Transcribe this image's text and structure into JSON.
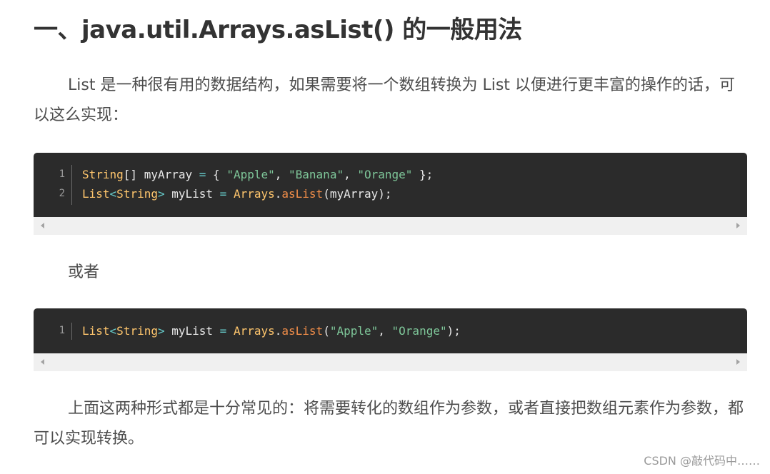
{
  "title": "一、java.util.Arrays.asList() 的一般用法",
  "paragraphs": {
    "intro": "List 是一种很有用的数据结构，如果需要将一个数组转换为 List 以便进行更丰富的操作的话，可以这么实现：",
    "or": "或者",
    "summary": "上面这两种形式都是十分常见的：将需要转化的数组作为参数，或者直接把数组元素作为参数，都可以实现转换。"
  },
  "code_block_1": {
    "lines": [
      {
        "number": "1",
        "tokens": [
          {
            "kind": "type",
            "text": "String"
          },
          {
            "kind": "plain",
            "text": "[] myArray "
          },
          {
            "kind": "op",
            "text": "="
          },
          {
            "kind": "plain",
            "text": " { "
          },
          {
            "kind": "str",
            "text": "\"Apple\""
          },
          {
            "kind": "plain",
            "text": ", "
          },
          {
            "kind": "str",
            "text": "\"Banana\""
          },
          {
            "kind": "plain",
            "text": ", "
          },
          {
            "kind": "str",
            "text": "\"Orange\""
          },
          {
            "kind": "plain",
            "text": " };"
          }
        ]
      },
      {
        "number": "2",
        "tokens": [
          {
            "kind": "type",
            "text": "List"
          },
          {
            "kind": "op",
            "text": "<"
          },
          {
            "kind": "type",
            "text": "String"
          },
          {
            "kind": "op",
            "text": ">"
          },
          {
            "kind": "plain",
            "text": " myList "
          },
          {
            "kind": "op",
            "text": "="
          },
          {
            "kind": "plain",
            "text": " "
          },
          {
            "kind": "type",
            "text": "Arrays"
          },
          {
            "kind": "plain",
            "text": "."
          },
          {
            "kind": "fn",
            "text": "asList"
          },
          {
            "kind": "plain",
            "text": "(myArray);"
          }
        ]
      }
    ]
  },
  "code_block_2": {
    "lines": [
      {
        "number": "1",
        "tokens": [
          {
            "kind": "type",
            "text": "List"
          },
          {
            "kind": "op",
            "text": "<"
          },
          {
            "kind": "type",
            "text": "String"
          },
          {
            "kind": "op",
            "text": ">"
          },
          {
            "kind": "plain",
            "text": " myList "
          },
          {
            "kind": "op",
            "text": "="
          },
          {
            "kind": "plain",
            "text": " "
          },
          {
            "kind": "type",
            "text": "Arrays"
          },
          {
            "kind": "plain",
            "text": "."
          },
          {
            "kind": "fn",
            "text": "asList"
          },
          {
            "kind": "plain",
            "text": "("
          },
          {
            "kind": "str",
            "text": "\"Apple\""
          },
          {
            "kind": "plain",
            "text": ", "
          },
          {
            "kind": "str",
            "text": "\"Orange\""
          },
          {
            "kind": "plain",
            "text": ");"
          }
        ]
      }
    ]
  },
  "watermark": "CSDN @敲代码中……",
  "colors": {
    "code_background": "#2b2b2b",
    "type": "#ffc66d",
    "string": "#7ec699",
    "operator": "#67cdcc",
    "function": "#f08d49",
    "plain": "#e8e8e8",
    "scrollbar": "#f0f0f0"
  },
  "icons": {
    "scroll_left": "scroll-left-arrow-icon",
    "scroll_right": "scroll-right-arrow-icon"
  }
}
